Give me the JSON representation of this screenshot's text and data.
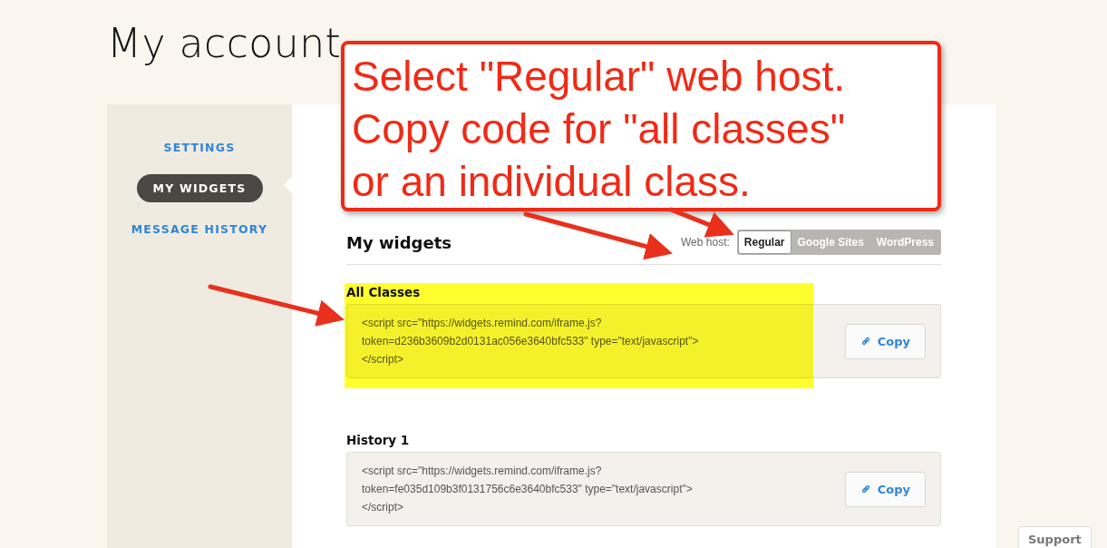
{
  "page_title": "My account",
  "sidebar": {
    "items": [
      {
        "label": "SETTINGS",
        "selected": false
      },
      {
        "label": "MY WIDGETS",
        "selected": true
      },
      {
        "label": "MESSAGE HISTORY",
        "selected": false
      }
    ]
  },
  "section_title": "My widgets",
  "web_host": {
    "label": "Web host:",
    "options": [
      {
        "label": "Regular",
        "selected": true
      },
      {
        "label": "Google Sites",
        "selected": false
      },
      {
        "label": "WordPress",
        "selected": false
      }
    ]
  },
  "widgets": [
    {
      "title": "All Classes",
      "highlighted": true,
      "code_lines": [
        "<script src=\"https://widgets.remind.com/iframe.js?",
        "token=d236b3609b2d0131ac056e3640bfc533\" type=\"text/javascript\">",
        "</script>"
      ],
      "button": "Copy"
    },
    {
      "title": "History 1",
      "highlighted": false,
      "code_lines": [
        "<script src=\"https://widgets.remind.com/iframe.js?",
        "token=fe035d109b3f0131756c6e3640bfc533\" type=\"text/javascript\">",
        "</script>"
      ],
      "button": "Copy"
    }
  ],
  "annotation": {
    "lines": [
      "Select \"Regular\" web host.",
      "Copy code for \"all classes\"",
      "or an individual class."
    ]
  },
  "support_button": "Support"
}
